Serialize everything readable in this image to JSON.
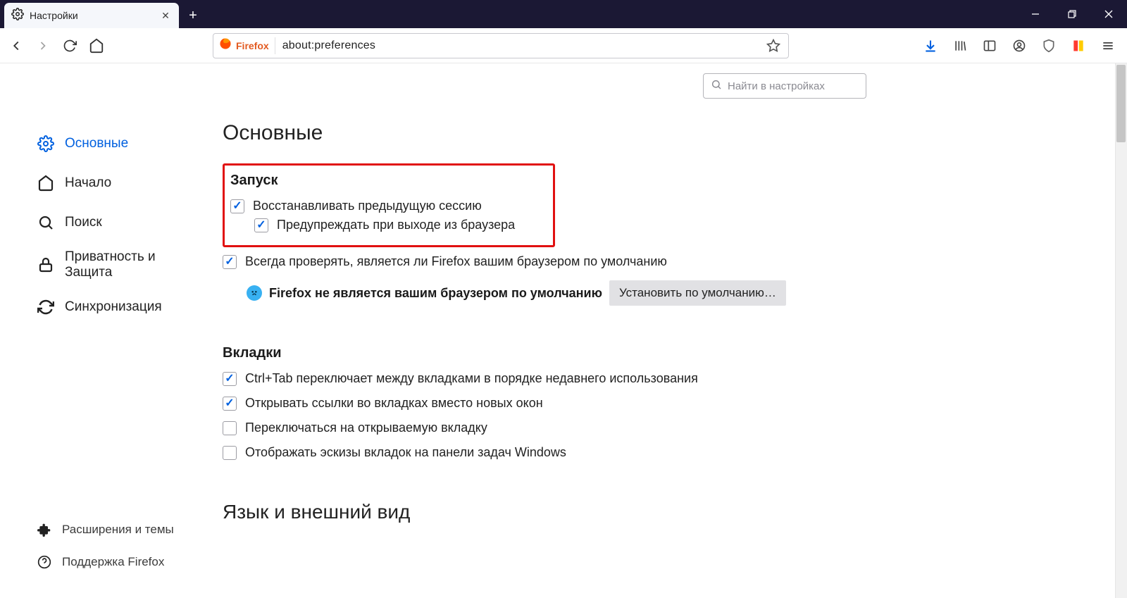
{
  "tab": {
    "title": "Настройки"
  },
  "urlbar": {
    "brand": "Firefox",
    "url": "about:preferences"
  },
  "search": {
    "placeholder": "Найти в настройках"
  },
  "sidebar": {
    "items": [
      {
        "label": "Основные"
      },
      {
        "label": "Начало"
      },
      {
        "label": "Поиск"
      },
      {
        "label": "Приватность и Защита"
      },
      {
        "label": "Синхронизация"
      }
    ],
    "footer": [
      {
        "label": "Расширения и темы"
      },
      {
        "label": "Поддержка Firefox"
      }
    ]
  },
  "main": {
    "title": "Основные",
    "startup": {
      "title": "Запуск",
      "restore_session": "Восстанавливать предыдущую сессию",
      "warn_on_exit": "Предупреждать при выходе из браузера",
      "always_check_default": "Всегда проверять, является ли Firefox вашим браузером по умолчанию",
      "not_default_msg": "Firefox не является вашим браузером по умолчанию",
      "set_default_btn": "Установить по умолчанию…"
    },
    "tabs": {
      "title": "Вкладки",
      "ctrl_tab": "Ctrl+Tab переключает между вкладками в порядке недавнего использования",
      "open_in_tabs": "Открывать ссылки во вкладках вместо новых окон",
      "switch_to_opened": "Переключаться на открываемую вкладку",
      "show_thumbnails": "Отображать эскизы вкладок на панели задач Windows"
    },
    "lang_section": "Язык и внешний вид"
  }
}
